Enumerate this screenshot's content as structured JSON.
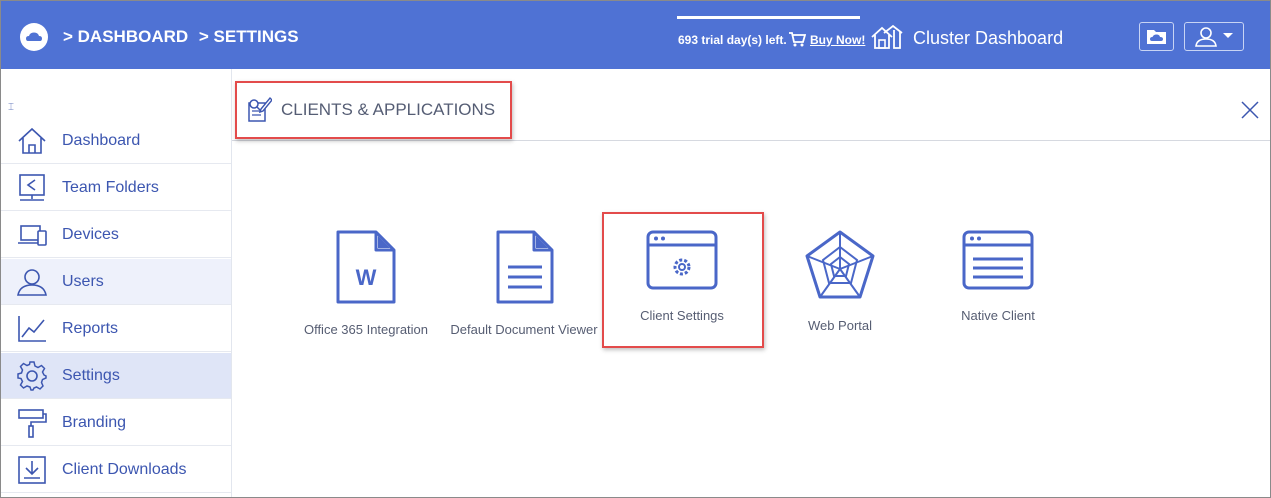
{
  "header": {
    "breadcrumb": [
      "> DASHBOARD",
      "> SETTINGS"
    ],
    "trial_text": "693 trial day(s) left.",
    "buy_now": "Buy Now!",
    "cluster_label": "Cluster Dashboard"
  },
  "sidebar": {
    "collapse_symbol": "⌶",
    "items": [
      {
        "label": "Dashboard",
        "icon": "home-icon"
      },
      {
        "label": "Team Folders",
        "icon": "team-folder-icon"
      },
      {
        "label": "Devices",
        "icon": "devices-icon"
      },
      {
        "label": "Users",
        "icon": "user-icon"
      },
      {
        "label": "Reports",
        "icon": "chart-icon"
      },
      {
        "label": "Settings",
        "icon": "gear-icon"
      },
      {
        "label": "Branding",
        "icon": "paint-roller-icon"
      },
      {
        "label": "Client Downloads",
        "icon": "download-icon"
      }
    ],
    "active": "Settings"
  },
  "main": {
    "title": "CLIENTS & APPLICATIONS",
    "tiles": [
      {
        "label": "Office 365 Integration",
        "icon": "word-document-icon"
      },
      {
        "label": "Default Document Viewer",
        "icon": "document-icon"
      },
      {
        "label": "Client Settings",
        "icon": "window-gear-icon"
      },
      {
        "label": "Web Portal",
        "icon": "web-icon"
      },
      {
        "label": "Native Client",
        "icon": "window-icon"
      }
    ]
  },
  "colors": {
    "topbar": "#4f72d4",
    "accent": "#3c56b0",
    "highlight": "#e34b4b"
  }
}
